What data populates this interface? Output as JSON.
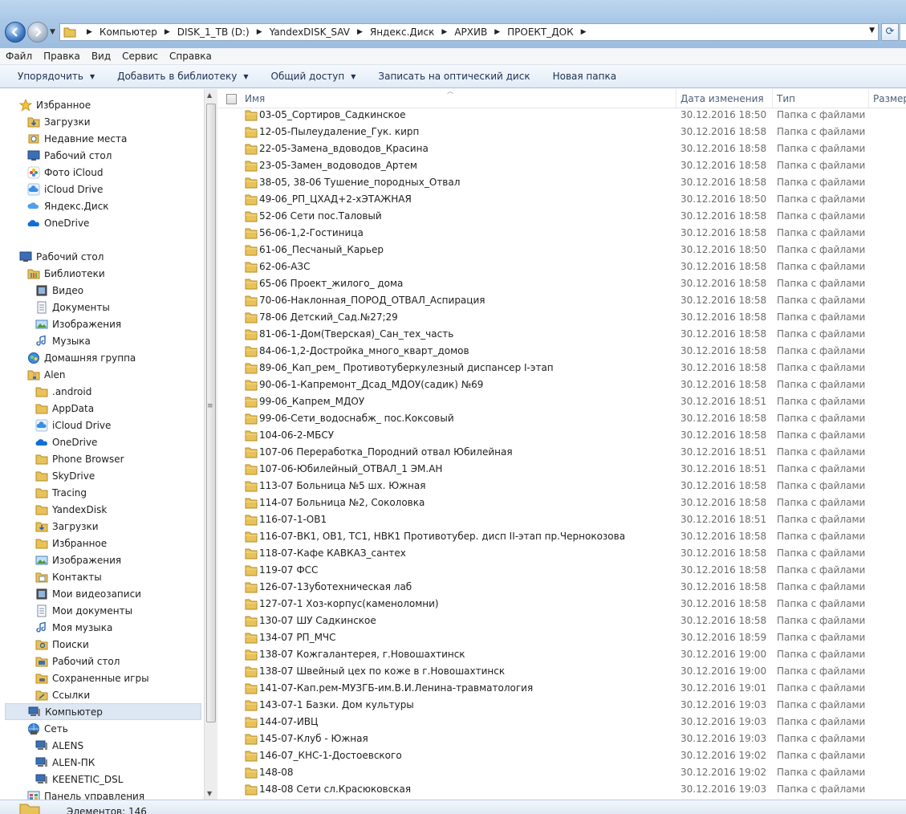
{
  "address": {
    "crumbs": [
      "Компьютер",
      "DISK_1_TB (D:)",
      "YandexDISK_SAV",
      "Яндекс.Диск",
      "АРХИВ",
      "ПРОЕКТ_ДОК"
    ]
  },
  "menu": [
    "Файл",
    "Правка",
    "Вид",
    "Сервис",
    "Справка"
  ],
  "toolbar": {
    "organize": "Упорядочить",
    "add_library": "Добавить в библиотеку",
    "share": "Общий доступ",
    "burn": "Записать на оптический диск",
    "new_folder": "Новая папка"
  },
  "nav": [
    {
      "label": "Избранное",
      "icon": "star-icon",
      "level": 0
    },
    {
      "label": "Загрузки",
      "icon": "downloads-icon",
      "level": 1
    },
    {
      "label": "Недавние места",
      "icon": "recent-places-icon",
      "level": 1
    },
    {
      "label": "Рабочий стол",
      "icon": "desktop-icon",
      "level": 1
    },
    {
      "label": "Фото iCloud",
      "icon": "icloud-photos-icon",
      "level": 1
    },
    {
      "label": "iCloud Drive",
      "icon": "icloud-drive-icon",
      "level": 1
    },
    {
      "label": "Яндекс.Диск",
      "icon": "yandex-disk-icon",
      "level": 1
    },
    {
      "label": "OneDrive",
      "icon": "onedrive-icon",
      "level": 1
    },
    {
      "label": "",
      "icon": "",
      "level": -1
    },
    {
      "label": "Рабочий стол",
      "icon": "desktop-icon",
      "level": 0
    },
    {
      "label": "Библиотеки",
      "icon": "libraries-icon",
      "level": 1
    },
    {
      "label": "Видео",
      "icon": "video-icon",
      "level": 2
    },
    {
      "label": "Документы",
      "icon": "documents-icon",
      "level": 2
    },
    {
      "label": "Изображения",
      "icon": "pictures-icon",
      "level": 2
    },
    {
      "label": "Музыка",
      "icon": "music-icon",
      "level": 2
    },
    {
      "label": "Домашняя группа",
      "icon": "homegroup-icon",
      "level": 1
    },
    {
      "label": "Alen",
      "icon": "user-folder-icon",
      "level": 1
    },
    {
      "label": ".android",
      "icon": "folder-icon",
      "level": 2
    },
    {
      "label": "AppData",
      "icon": "folder-icon",
      "level": 2
    },
    {
      "label": "iCloud Drive",
      "icon": "icloud-drive-icon",
      "level": 2
    },
    {
      "label": "OneDrive",
      "icon": "onedrive-icon",
      "level": 2
    },
    {
      "label": "Phone Browser",
      "icon": "folder-icon",
      "level": 2
    },
    {
      "label": "SkyDrive",
      "icon": "folder-icon",
      "level": 2
    },
    {
      "label": "Tracing",
      "icon": "folder-icon",
      "level": 2
    },
    {
      "label": "YandexDisk",
      "icon": "folder-icon",
      "level": 2
    },
    {
      "label": "Загрузки",
      "icon": "downloads-icon",
      "level": 2
    },
    {
      "label": "Избранное",
      "icon": "favorites-folder-icon",
      "level": 2
    },
    {
      "label": "Изображения",
      "icon": "pictures-icon",
      "level": 2
    },
    {
      "label": "Контакты",
      "icon": "contacts-icon",
      "level": 2
    },
    {
      "label": "Мои видеозаписи",
      "icon": "video-icon",
      "level": 2
    },
    {
      "label": "Мои документы",
      "icon": "documents-icon",
      "level": 2
    },
    {
      "label": "Моя музыка",
      "icon": "music-icon",
      "level": 2
    },
    {
      "label": "Поиски",
      "icon": "searches-icon",
      "level": 2
    },
    {
      "label": "Рабочий стол",
      "icon": "desktop-folder-icon",
      "level": 2
    },
    {
      "label": "Сохраненные игры",
      "icon": "saved-games-icon",
      "level": 2
    },
    {
      "label": "Ссылки",
      "icon": "links-icon",
      "level": 2
    },
    {
      "label": "Компьютер",
      "icon": "computer-icon",
      "level": 1,
      "selected": true
    },
    {
      "label": "Сеть",
      "icon": "network-icon",
      "level": 1
    },
    {
      "label": "ALENS",
      "icon": "network-computer-icon",
      "level": 2
    },
    {
      "label": "ALEN-ПК",
      "icon": "network-computer-icon",
      "level": 2
    },
    {
      "label": "KEENETIC_DSL",
      "icon": "network-computer-icon",
      "level": 2
    },
    {
      "label": "Панель управления",
      "icon": "control-panel-icon",
      "level": 1
    }
  ],
  "columns": {
    "name": "Имя",
    "date": "Дата изменения",
    "type": "Тип",
    "size": "Размер"
  },
  "files": [
    {
      "name": "03-05_Сортиров_Садкинское",
      "date": "30.12.2016 18:50",
      "type": "Папка с файлами"
    },
    {
      "name": "12-05-Пылеудаление_Гук. кирп",
      "date": "30.12.2016 18:58",
      "type": "Папка с файлами"
    },
    {
      "name": "22-05-Замена_вдоводов_Красина",
      "date": "30.12.2016 18:58",
      "type": "Папка с файлами"
    },
    {
      "name": "23-05-Замен_водоводов_Артем",
      "date": "30.12.2016 18:58",
      "type": "Папка с файлами"
    },
    {
      "name": "38-05, 38-06 Тушение_породных_Отвал",
      "date": "30.12.2016 18:58",
      "type": "Папка с файлами"
    },
    {
      "name": "49-06_РП_ЦХАД+2-хЭТАЖНАЯ",
      "date": "30.12.2016 18:50",
      "type": "Папка с файлами"
    },
    {
      "name": "52-06 Сети пос.Таловый",
      "date": "30.12.2016 18:58",
      "type": "Папка с файлами"
    },
    {
      "name": "56-06-1,2-Гостиница",
      "date": "30.12.2016 18:58",
      "type": "Папка с файлами"
    },
    {
      "name": "61-06_Песчаный_Карьер",
      "date": "30.12.2016 18:50",
      "type": "Папка с файлами"
    },
    {
      "name": "62-06-АЗС",
      "date": "30.12.2016 18:58",
      "type": "Папка с файлами"
    },
    {
      "name": "65-06 Проект_жилого_ дома",
      "date": "30.12.2016 18:58",
      "type": "Папка с файлами"
    },
    {
      "name": "70-06-Наклонная_ПОРОД_ОТВАЛ_Аспирация",
      "date": "30.12.2016 18:58",
      "type": "Папка с файлами"
    },
    {
      "name": "78-06 Детский_Сад.№27;29",
      "date": "30.12.2016 18:58",
      "type": "Папка с файлами"
    },
    {
      "name": "81-06-1-Дом(Тверская)_Сан_тех_часть",
      "date": "30.12.2016 18:58",
      "type": "Папка с файлами"
    },
    {
      "name": "84-06-1,2-Достройка_много_кварт_домов",
      "date": "30.12.2016 18:58",
      "type": "Папка с файлами"
    },
    {
      "name": "89-06_Кап_рем_ Противотуберкулезный диспансер I-этап",
      "date": "30.12.2016 18:58",
      "type": "Папка с файлами"
    },
    {
      "name": "90-06-1-Капремонт_Дсад_МДОУ(садик) №69",
      "date": "30.12.2016 18:58",
      "type": "Папка с файлами"
    },
    {
      "name": "99-06_Капрем_МДОУ",
      "date": "30.12.2016 18:51",
      "type": "Папка с файлами"
    },
    {
      "name": "99-06-Сети_водоснабж_ пос.Коксовый",
      "date": "30.12.2016 18:58",
      "type": "Папка с файлами"
    },
    {
      "name": "104-06-2-МБСУ",
      "date": "30.12.2016 18:58",
      "type": "Папка с файлами"
    },
    {
      "name": "107-06  Переработка_Породний отвал Юбилейная",
      "date": "30.12.2016 18:51",
      "type": "Папка с файлами"
    },
    {
      "name": "107-06-Юбилейный_ОТВАЛ_1 ЭМ.АН",
      "date": "30.12.2016 18:51",
      "type": "Папка с файлами"
    },
    {
      "name": "113-07 Больница №5 шх. Южная",
      "date": "30.12.2016 18:58",
      "type": "Папка с файлами"
    },
    {
      "name": "114-07 Больница №2, Соколовка",
      "date": "30.12.2016 18:58",
      "type": "Папка с файлами"
    },
    {
      "name": "116-07-1-ОВ1",
      "date": "30.12.2016 18:51",
      "type": "Папка с файлами"
    },
    {
      "name": "116-07-ВК1, ОВ1, ТС1, НВК1 Противотубер. дисп II-этап пр.Чернокозова",
      "date": "30.12.2016 18:58",
      "type": "Папка с файлами"
    },
    {
      "name": "118-07-Кафе КАВКАЗ_сантех",
      "date": "30.12.2016 18:58",
      "type": "Папка с файлами"
    },
    {
      "name": "119-07 ФСС",
      "date": "30.12.2016 18:58",
      "type": "Папка с файлами"
    },
    {
      "name": "126-07-13убoтехническая лаб",
      "date": "30.12.2016 18:58",
      "type": "Папка с файлами"
    },
    {
      "name": "127-07-1 Хоз-корпус(каменоломни)",
      "date": "30.12.2016 18:58",
      "type": "Папка с файлами"
    },
    {
      "name": "130-07 ШУ Садкинское",
      "date": "30.12.2016 18:58",
      "type": "Папка с файлами"
    },
    {
      "name": "134-07 РП_МЧС",
      "date": "30.12.2016 18:59",
      "type": "Папка с файлами"
    },
    {
      "name": "138-07 Кожгалантерея, г.Новошахтинск",
      "date": "30.12.2016 19:00",
      "type": "Папка с файлами"
    },
    {
      "name": "138-07 Швейный цех по коже в г.Новошахтинск",
      "date": "30.12.2016 19:00",
      "type": "Папка с файлами"
    },
    {
      "name": "141-07-Кап.рем-МУЗГБ-им.В.И.Ленина-травматология",
      "date": "30.12.2016 19:01",
      "type": "Папка с файлами"
    },
    {
      "name": "143-07-1 Базки. Дом культуры",
      "date": "30.12.2016 19:03",
      "type": "Папка с файлами"
    },
    {
      "name": "144-07-ИВЦ",
      "date": "30.12.2016 19:03",
      "type": "Папка с файлами"
    },
    {
      "name": "145-07-Клуб - Южная",
      "date": "30.12.2016 19:03",
      "type": "Папка с файлами"
    },
    {
      "name": "146-07_КНС-1-Достоевского",
      "date": "30.12.2016 19:02",
      "type": "Папка с файлами"
    },
    {
      "name": "148-08",
      "date": "30.12.2016 19:02",
      "type": "Папка с файлами"
    },
    {
      "name": "148-08 Сети сл.Красюковская",
      "date": "30.12.2016 19:03",
      "type": "Папка с файлами"
    }
  ],
  "status": {
    "text": "Элементов: 146"
  }
}
